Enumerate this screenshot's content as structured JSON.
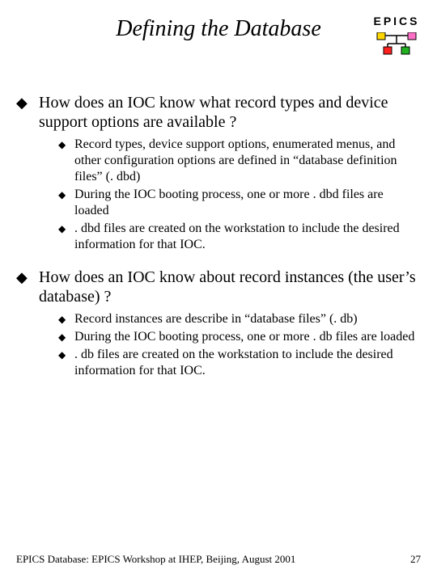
{
  "title": "Defining the Database",
  "logo_text": "EPICS",
  "sections": [
    {
      "heading": "How does an IOC know what record types and device support options are available ?",
      "items": [
        "Record types, device support options, enumerated menus, and other configuration options are defined in “database definition files” (. dbd)",
        "During the IOC booting process, one or more . dbd files are loaded",
        ". dbd files are created on the workstation to include the desired information for that IOC."
      ]
    },
    {
      "heading": "How does an IOC know about record instances (the user’s database) ?",
      "items": [
        "Record instances are describe in “database files” (. db)",
        "During the IOC booting process, one or more . db files are loaded",
        ". db files are created on the workstation to include the desired information for that IOC."
      ]
    }
  ],
  "footer_left": "EPICS Database: EPICS Workshop at IHEP, Beijing, August 2001",
  "footer_right": "27"
}
